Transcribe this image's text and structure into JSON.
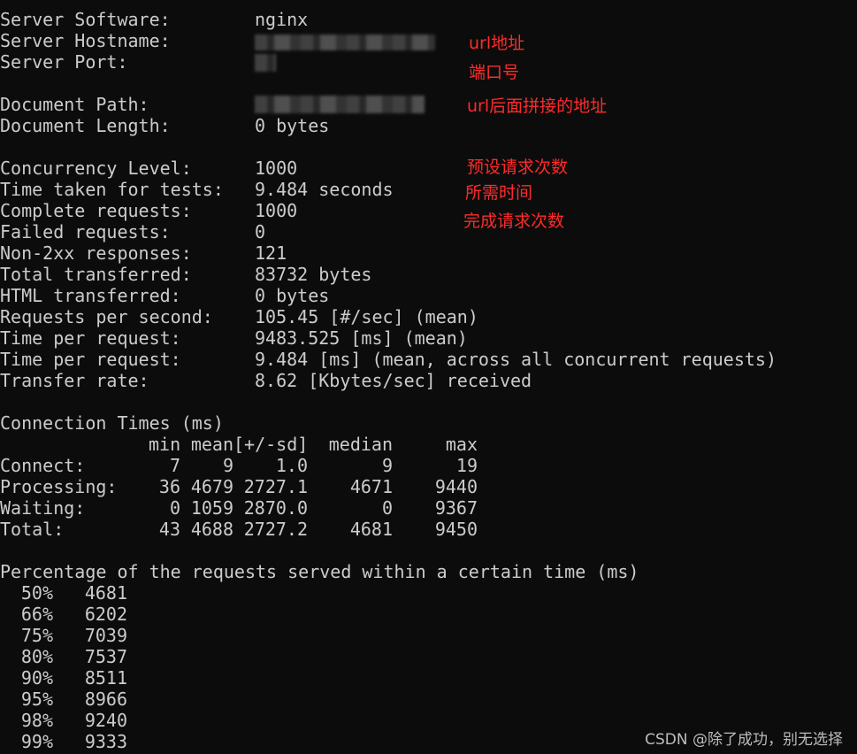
{
  "server": [
    {
      "label": "Server Software:",
      "value": "nginx"
    },
    {
      "label": "Server Hostname:",
      "value": ""
    },
    {
      "label": "Server Port:",
      "value": ""
    }
  ],
  "document": [
    {
      "label": "Document Path:",
      "value": ""
    },
    {
      "label": "Document Length:",
      "value": "0 bytes"
    }
  ],
  "stats": [
    {
      "label": "Concurrency Level:",
      "value": "1000"
    },
    {
      "label": "Time taken for tests:",
      "value": "9.484 seconds"
    },
    {
      "label": "Complete requests:",
      "value": "1000"
    },
    {
      "label": "Failed requests:",
      "value": "0"
    },
    {
      "label": "Non-2xx responses:",
      "value": "121"
    },
    {
      "label": "Total transferred:",
      "value": "83732 bytes"
    },
    {
      "label": "HTML transferred:",
      "value": "0 bytes"
    },
    {
      "label": "Requests per second:",
      "value": "105.45 [#/sec] (mean)"
    },
    {
      "label": "Time per request:",
      "value": "9483.525 [ms] (mean)"
    },
    {
      "label": "Time per request:",
      "value": "9.484 [ms] (mean, across all concurrent requests)"
    },
    {
      "label": "Transfer rate:",
      "value": "8.62 [Kbytes/sec] received"
    }
  ],
  "connection": {
    "title": "Connection Times (ms)",
    "headers": [
      "",
      "min",
      "mean",
      "[+/-sd]",
      "median",
      "max"
    ],
    "rows": [
      {
        "name": "Connect:",
        "min": "7",
        "mean": "9",
        "sd": "1.0",
        "median": "9",
        "max": "19"
      },
      {
        "name": "Processing:",
        "min": "36",
        "mean": "4679",
        "sd": "2727.1",
        "median": "4671",
        "max": "9440"
      },
      {
        "name": "Waiting:",
        "min": "0",
        "mean": "1059",
        "sd": "2870.0",
        "median": "0",
        "max": "9367"
      },
      {
        "name": "Total:",
        "min": "43",
        "mean": "4688",
        "sd": "2727.2",
        "median": "4681",
        "max": "9450"
      }
    ]
  },
  "percentiles": {
    "title": "Percentage of the requests served within a certain time (ms)",
    "rows": [
      {
        "p": "50%",
        "v": "4681"
      },
      {
        "p": "66%",
        "v": "6202"
      },
      {
        "p": "75%",
        "v": "7039"
      },
      {
        "p": "80%",
        "v": "7537"
      },
      {
        "p": "90%",
        "v": "8511"
      },
      {
        "p": "95%",
        "v": "8966"
      },
      {
        "p": "98%",
        "v": "9240"
      },
      {
        "p": "99%",
        "v": "9333"
      }
    ]
  },
  "annotations": {
    "url": "url地址",
    "port": "端口号",
    "path": "url后面拼接的地址",
    "concurrency": "预设请求次数",
    "time": "所需时间",
    "complete": "完成请求次数"
  },
  "watermark": "CSDN @除了成功，别无选择",
  "colors": {
    "background": "#0c0c0c",
    "text": "#cccccc",
    "annotation": "#ff2b2b"
  }
}
